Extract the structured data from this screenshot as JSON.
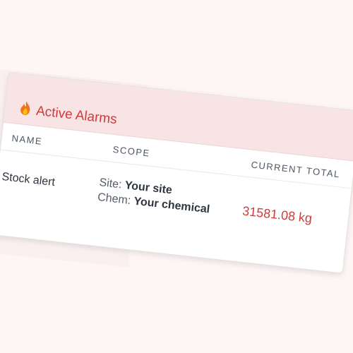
{
  "panel": {
    "title": "Active Alarms",
    "icon": "fire-icon",
    "accent_color": "#d23a3a",
    "header_bg": "#f8e4e4"
  },
  "table": {
    "headers": {
      "name": "NAME",
      "scope": "SCOPE",
      "current_total": "CURRENT TOTAL"
    },
    "rows": [
      {
        "name": "Stock alert",
        "site_label": "Site:",
        "site_value": "Your site",
        "chem_label": "Chem:",
        "chem_value": "Your chemical",
        "current_total": "31581.08 kg"
      }
    ]
  }
}
